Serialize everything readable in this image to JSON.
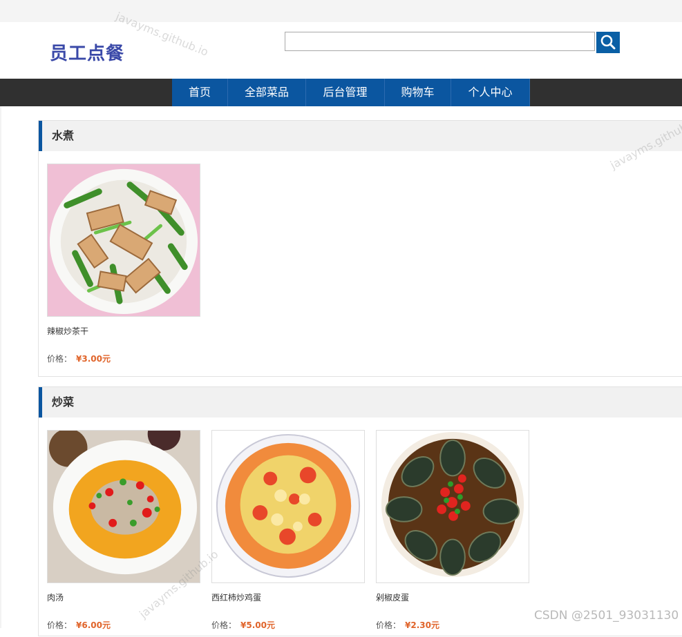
{
  "header": {
    "logo": "员工点餐",
    "search": {
      "value": "",
      "placeholder": ""
    }
  },
  "nav": {
    "items": [
      "首页",
      "全部菜品",
      "后台管理",
      "购物车",
      "个人中心"
    ]
  },
  "sections": [
    {
      "title": "水煮",
      "dishes": [
        {
          "name": "辣椒炒茶干",
          "price_label": "价格：",
          "price": "¥3.00元"
        }
      ]
    },
    {
      "title": "炒菜",
      "dishes": [
        {
          "name": "肉汤",
          "price_label": "价格：",
          "price": "¥6.00元"
        },
        {
          "name": "西红柿炒鸡蛋",
          "price_label": "价格：",
          "price": "¥5.00元"
        },
        {
          "name": "剁椒皮蛋",
          "price_label": "价格：",
          "price": "¥2.30元"
        }
      ]
    }
  ],
  "watermark": "javayms.github.io",
  "source_watermark": "CSDN @2501_93031130",
  "colors": {
    "brand_blue": "#0b56a0",
    "logo": "#3a49a8",
    "nav_bar": "#303030",
    "price": "#e0642a"
  }
}
